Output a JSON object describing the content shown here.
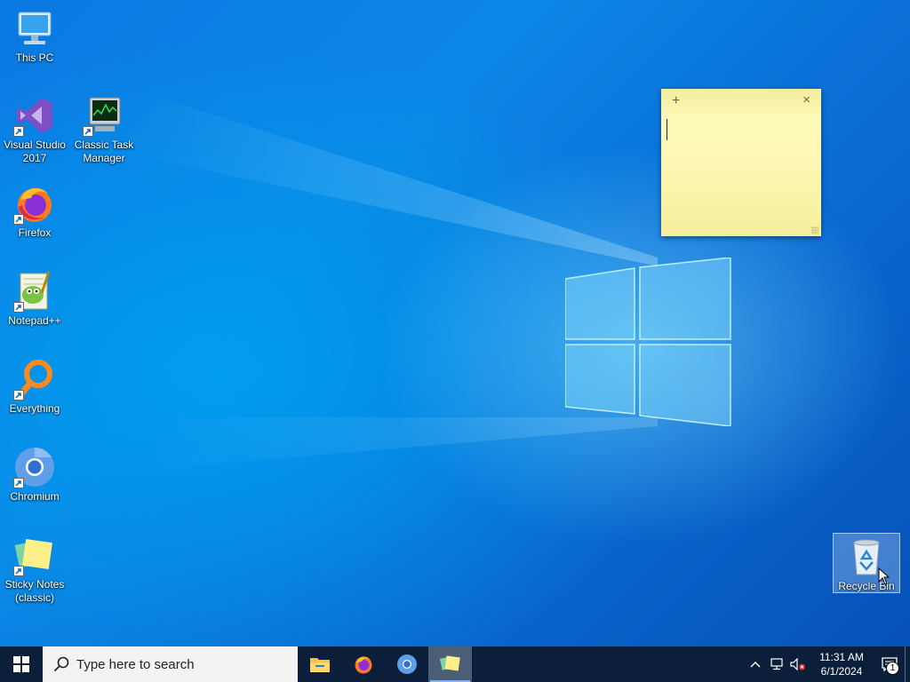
{
  "desktop": {
    "icons": [
      {
        "label": "This PC",
        "icon": "computer-icon"
      },
      {
        "label": "Visual Studio 2017",
        "icon": "visual-studio-icon"
      },
      {
        "label": "Classic Task Manager",
        "icon": "task-manager-icon"
      },
      {
        "label": "Firefox",
        "icon": "firefox-icon"
      },
      {
        "label": "Notepad++",
        "icon": "notepadplusplus-icon"
      },
      {
        "label": "Everything",
        "icon": "everything-search-icon"
      },
      {
        "label": "Chromium",
        "icon": "chromium-icon"
      },
      {
        "label": "Sticky Notes (classic)",
        "icon": "sticky-notes-icon"
      },
      {
        "label": "Recycle Bin",
        "icon": "recycle-bin-icon"
      }
    ]
  },
  "sticky_note": {
    "add_glyph": "+",
    "close_glyph": "×",
    "text": ""
  },
  "taskbar": {
    "search_placeholder": "Type here to search",
    "pinned": [
      "file-explorer-icon",
      "firefox-icon",
      "chromium-icon",
      "sticky-notes-icon"
    ],
    "active_app": "sticky-notes-icon",
    "clock_time": "11:31 AM",
    "clock_date": "6/1/2024",
    "notification_count": "1"
  },
  "colors": {
    "taskbar_bg": "#0c1f3a",
    "desktop_blue": "#0a79e2",
    "sticky_yellow": "#fdf8b8"
  }
}
